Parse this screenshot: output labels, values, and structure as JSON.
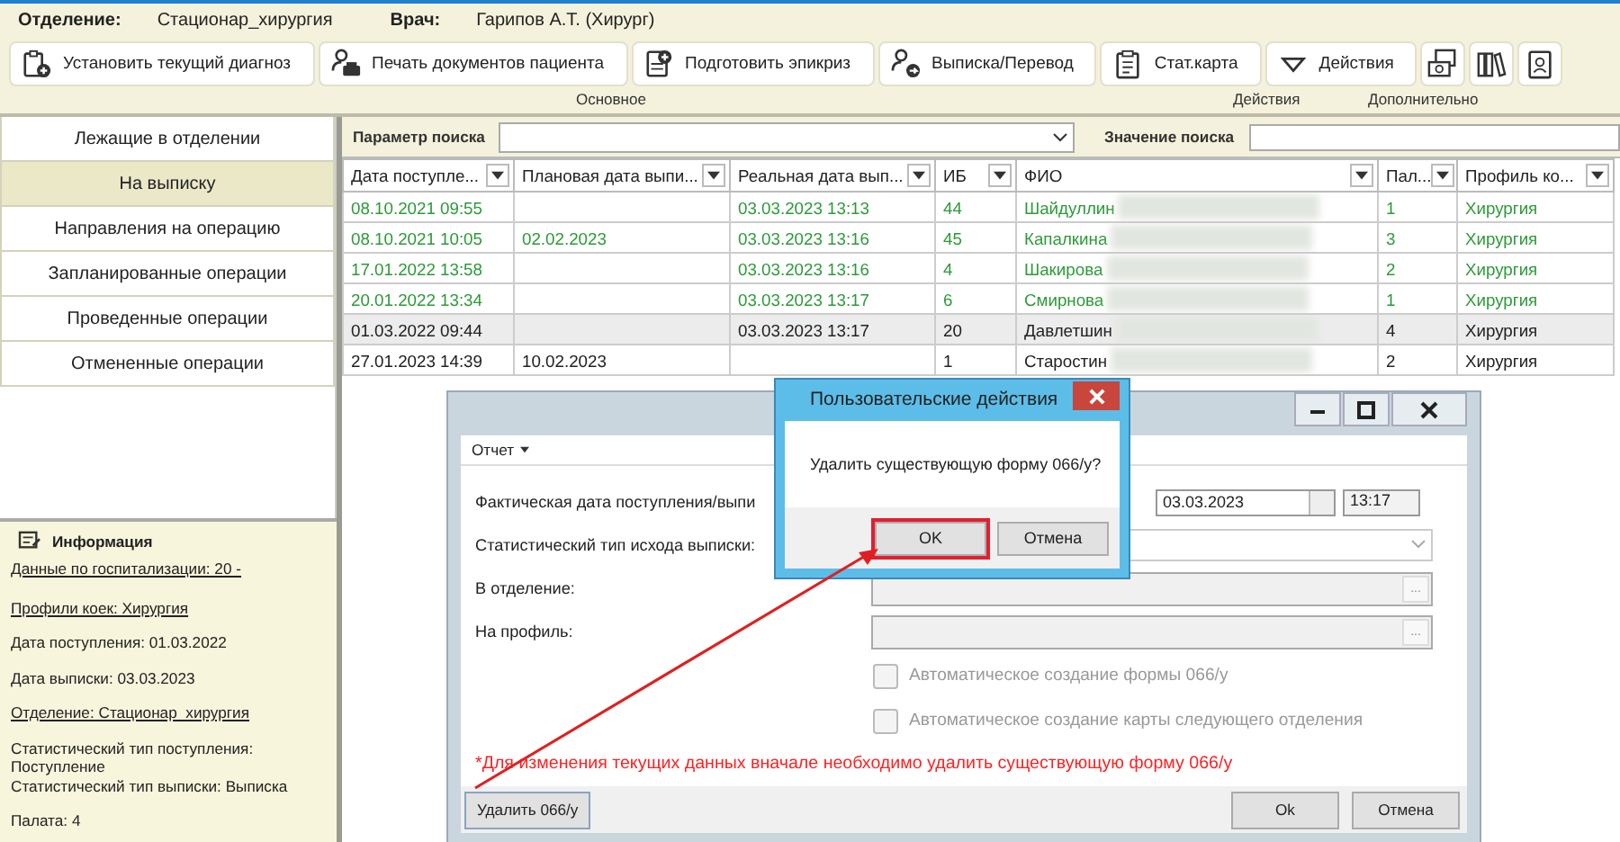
{
  "header": {
    "department_label": "Отделение:",
    "department": "Стационар_хирургия",
    "doctor_label": "Врач:",
    "doctor": "Гарипов А.Т. (Хирург)"
  },
  "toolbar": {
    "buttons": [
      {
        "kind": "diagnosis",
        "label": "Установить текущий диагноз"
      },
      {
        "kind": "print",
        "label": "Печать документов пациента"
      },
      {
        "kind": "epicrisis",
        "label": "Подготовить эпикриз"
      },
      {
        "kind": "discharge",
        "label": "Выписка/Перевод"
      },
      {
        "kind": "clipboard",
        "label": "Стат.карта"
      },
      {
        "kind": "dropdown",
        "label": "Действия"
      },
      {
        "kind": "money"
      },
      {
        "kind": "books"
      },
      {
        "kind": "badge"
      }
    ],
    "groups": [
      "Основное",
      "Действия",
      "Дополнительно"
    ]
  },
  "sidebar": {
    "items": [
      {
        "label": "Лежащие в отделении",
        "selected": false
      },
      {
        "label": "На выписку",
        "selected": true
      },
      {
        "label": "Направления на операцию",
        "selected": false
      },
      {
        "label": "Запланированные операции",
        "selected": false
      },
      {
        "label": "Проведенные операции",
        "selected": false
      },
      {
        "label": "Отмененные операции",
        "selected": false
      }
    ],
    "info": {
      "title": "Информация",
      "lines": [
        {
          "kind": "link",
          "text": "Данные по госпитализации: 20 -"
        },
        {
          "kind": "redacted"
        },
        {
          "kind": "link",
          "text": "Профили коек: Хирургия"
        },
        {
          "kind": "text",
          "text": "Дата поступления: 01.03.2022"
        },
        {
          "kind": "text",
          "text": "Дата выписки: 03.03.2023"
        },
        {
          "kind": "link",
          "text": "Отделение: Стационар_хирургия"
        },
        {
          "kind": "text",
          "text": "Статистический тип поступления: Поступление"
        },
        {
          "kind": "tight",
          "text": "Статистический тип выписки: Выписка"
        },
        {
          "kind": "text",
          "text": "Палата: 4"
        }
      ]
    }
  },
  "search": {
    "param_label": "Параметр поиска",
    "value_label": "Значение поиска"
  },
  "table": {
    "columns": [
      "Дата поступле...",
      "Плановая дата выпи...",
      "Реальная дата вып...",
      "ИБ",
      "ФИО",
      "Пал...",
      "Профиль ко..."
    ],
    "rows": [
      {
        "color": "#2e9a3a",
        "selected": false,
        "cells": [
          "08.10.2021 09:55",
          "",
          "03.03.2023 13:13",
          "44",
          "Шайдуллин",
          "1",
          "Хирургия"
        ]
      },
      {
        "color": "#2e9a3a",
        "selected": false,
        "cells": [
          "08.10.2021 10:05",
          "02.02.2023",
          "03.03.2023 13:16",
          "45",
          "Капалкина",
          "3",
          "Хирургия"
        ]
      },
      {
        "color": "#2e9a3a",
        "selected": false,
        "cells": [
          "17.01.2022 13:58",
          "",
          "03.03.2023 13:16",
          "4",
          "Шакирова",
          "2",
          "Хирургия"
        ]
      },
      {
        "color": "#2e9a3a",
        "selected": false,
        "cells": [
          "20.01.2022 13:34",
          "",
          "03.03.2023 13:17",
          "6",
          "Смирнова",
          "1",
          "Хирургия"
        ]
      },
      {
        "color": "#222222",
        "selected": true,
        "cells": [
          "01.03.2022 09:44",
          "",
          "03.03.2023 13:17",
          "20",
          "Давлетшин",
          "4",
          "Хирургия"
        ]
      },
      {
        "color": "#222222",
        "selected": false,
        "cells": [
          "27.01.2023 14:39",
          "10.02.2023",
          "",
          "1",
          "Старостин",
          "2",
          "Хирургия"
        ]
      }
    ]
  },
  "dialog": {
    "menu": "Отчет",
    "fields": [
      {
        "kind": "dates",
        "label": "Фактическая дата поступления/выпи",
        "date": "03.03.2023",
        "time": "13:17"
      },
      {
        "kind": "select",
        "label": "Статистический тип исхода выписки:"
      },
      {
        "kind": "picker",
        "label": "В отделение:",
        "button": "...",
        "disabled": true
      },
      {
        "kind": "picker",
        "label": "На профиль:",
        "button": "...",
        "disabled": true
      }
    ],
    "checkboxes": [
      {
        "label": "Автоматическое создание формы 066/у",
        "checked": false,
        "disabled": true
      },
      {
        "label": "Автоматическое создание карты следующего отделения",
        "checked": false,
        "disabled": true
      }
    ],
    "note": "*Для изменения текущих данных вначале необходимо удалить существующую форму 066/у",
    "left_button": "Удалить 066/у",
    "buttons": [
      "Ok",
      "Отмена"
    ]
  },
  "confirm": {
    "title": "Пользовательские действия",
    "message": "Удалить существующую форму 066/у?",
    "buttons": [
      {
        "label": "OK",
        "highlighted": true
      },
      {
        "label": "Отмена",
        "highlighted": false
      }
    ]
  }
}
